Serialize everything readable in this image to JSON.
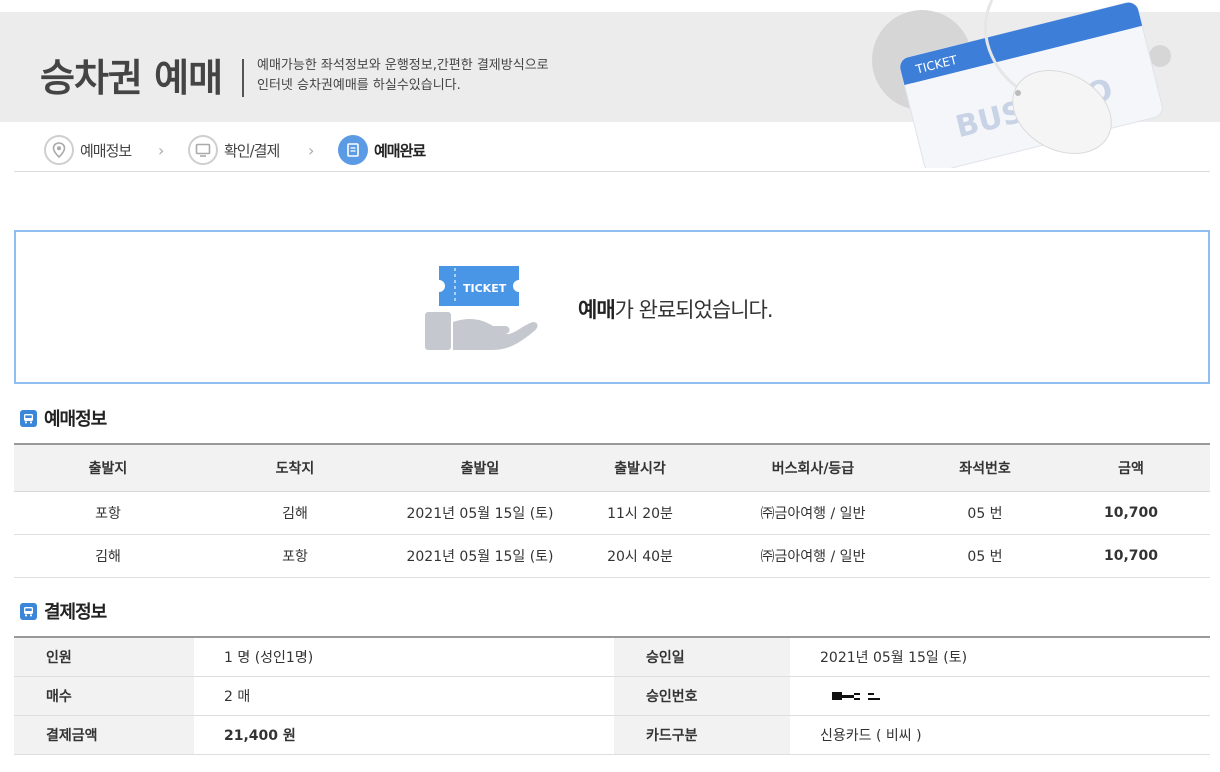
{
  "header": {
    "title": "승차권 예매",
    "desc_line1": "예매가능한 좌석정보와 운행정보,간편한 결제방식으로",
    "desc_line2": "인터넷 승차권예매를 하실수있습니다.",
    "art_ticket_label": "TICKET",
    "art_brand": "BUSTAGO"
  },
  "steps": [
    {
      "label": "예매정보",
      "icon": "location-pin-icon"
    },
    {
      "label": "확인/결제",
      "icon": "monitor-icon"
    },
    {
      "label": "예매완료",
      "icon": "document-icon"
    }
  ],
  "completion": {
    "ticket_label": "TICKET",
    "msg_bold": "예매",
    "msg_rest": "가 완료되었습니다."
  },
  "reservation": {
    "title": "예매정보",
    "columns": [
      "출발지",
      "도착지",
      "출발일",
      "출발시각",
      "버스회사/등급",
      "좌석번호",
      "금액"
    ],
    "rows": [
      [
        "포항",
        "김해",
        "2021년 05월 15일 (토)",
        "11시 20분",
        "㈜금아여행 / 일반",
        "05 번",
        "10,700"
      ],
      [
        "김해",
        "포항",
        "2021년 05월 15일 (토)",
        "20시 40분",
        "㈜금아여행 / 일반",
        "05 번",
        "10,700"
      ]
    ]
  },
  "payment": {
    "title": "결제정보",
    "rows": [
      {
        "label1": "인원",
        "value1": "1 명 (성인1명)",
        "label2": "승인일",
        "value2": "2021년 05월 15일 (토)"
      },
      {
        "label1": "매수",
        "value1": "2 매",
        "label2": "승인번호",
        "value2": ""
      },
      {
        "label1": "결제금액",
        "value1": "21,400 원",
        "label2": "카드구분",
        "value2": "신용카드  ( 비씨  )"
      }
    ]
  },
  "colors": {
    "accent": "#5b9be6",
    "border_blue": "#8fbff0",
    "section_icon": "#3a86d8"
  }
}
